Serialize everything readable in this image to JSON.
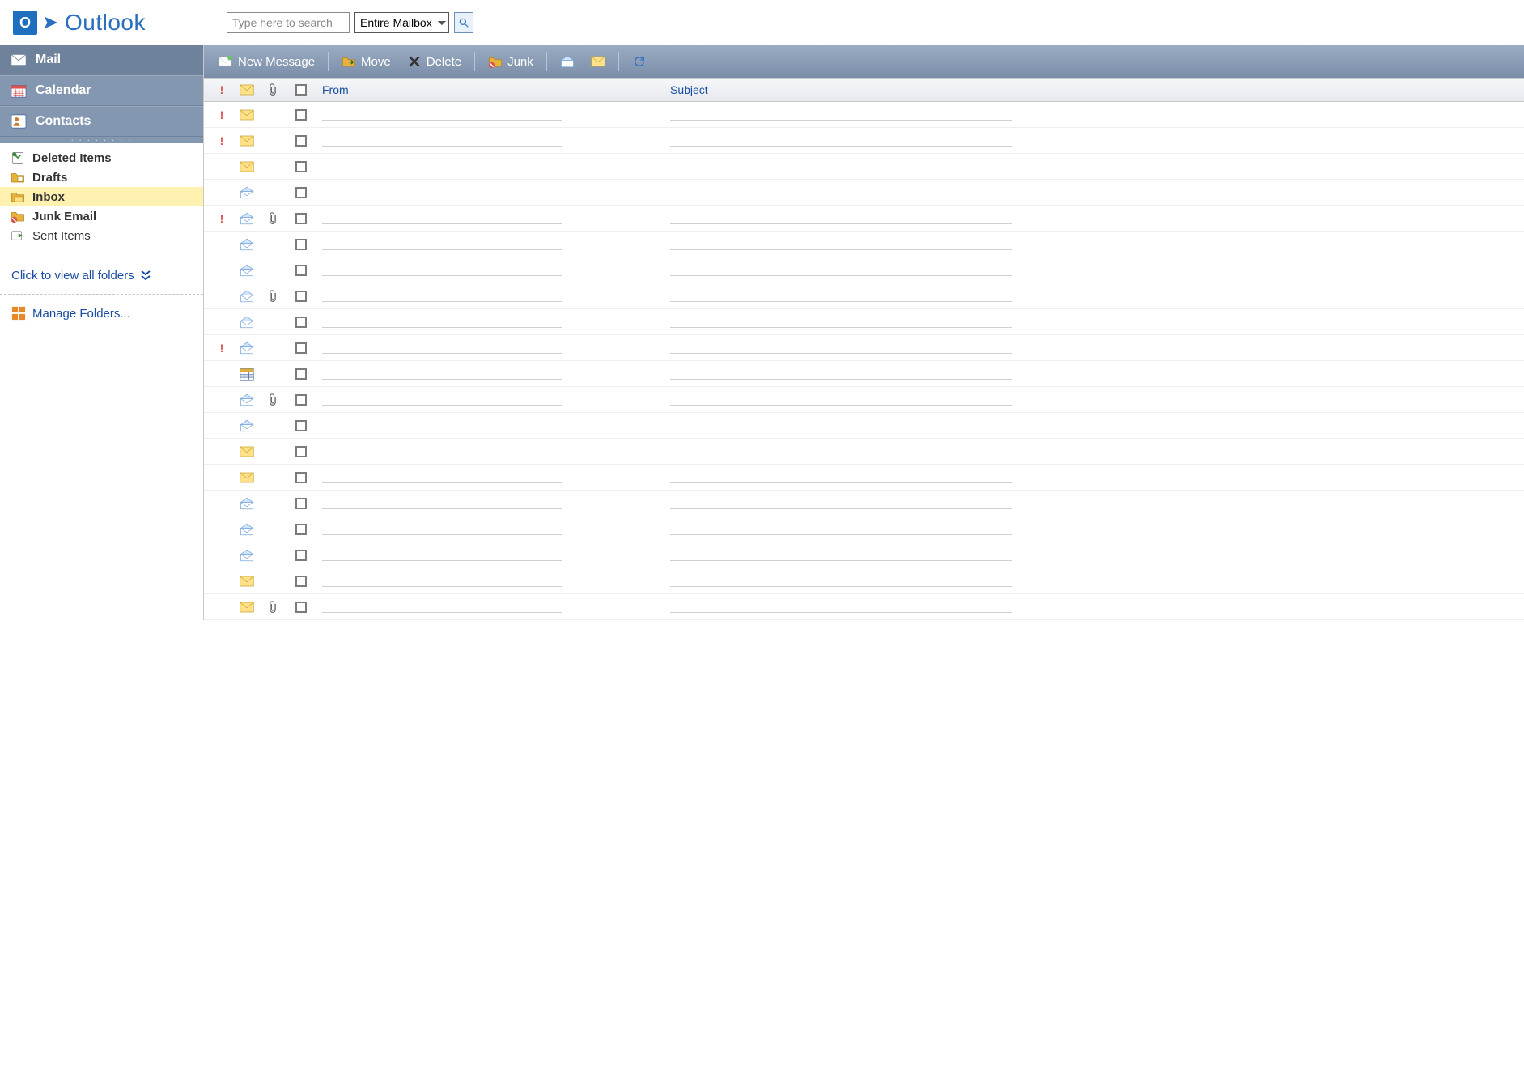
{
  "brand": {
    "az": "O",
    "name": "Outlook"
  },
  "search": {
    "placeholder": "Type here to search",
    "scope": "Entire Mailbox"
  },
  "nav": {
    "mail": "Mail",
    "calendar": "Calendar",
    "contacts": "Contacts"
  },
  "folders": [
    {
      "name": "Deleted Items",
      "icon": "trash",
      "bold": true,
      "selected": false
    },
    {
      "name": "Drafts",
      "icon": "drafts",
      "bold": true,
      "selected": false
    },
    {
      "name": "Inbox",
      "icon": "inbox",
      "bold": true,
      "selected": true
    },
    {
      "name": "Junk Email",
      "icon": "junk",
      "bold": true,
      "selected": false
    },
    {
      "name": "Sent Items",
      "icon": "sent",
      "bold": false,
      "selected": false
    }
  ],
  "sidebar_links": {
    "view_all": "Click to view all folders",
    "manage": "Manage Folders..."
  },
  "toolbar": {
    "new": "New Message",
    "move": "Move",
    "delete": "Delete",
    "junk": "Junk"
  },
  "columns": {
    "from": "From",
    "subject": "Subject"
  },
  "messages": [
    {
      "importance": true,
      "icon": "closed",
      "attach": false,
      "from": "",
      "subject": ""
    },
    {
      "importance": true,
      "icon": "closed",
      "attach": false,
      "from": "",
      "subject": ""
    },
    {
      "importance": false,
      "icon": "closed",
      "attach": false,
      "from": "",
      "subject": ""
    },
    {
      "importance": false,
      "icon": "open",
      "attach": false,
      "from": "",
      "subject": ""
    },
    {
      "importance": true,
      "icon": "open",
      "attach": true,
      "from": "",
      "subject": ""
    },
    {
      "importance": false,
      "icon": "open",
      "attach": false,
      "from": "",
      "subject": ""
    },
    {
      "importance": false,
      "icon": "open",
      "attach": false,
      "from": "",
      "subject": ""
    },
    {
      "importance": false,
      "icon": "open",
      "attach": true,
      "from": "",
      "subject": ""
    },
    {
      "importance": false,
      "icon": "open",
      "attach": false,
      "from": "",
      "subject": ""
    },
    {
      "importance": true,
      "icon": "open",
      "attach": false,
      "from": "",
      "subject": ""
    },
    {
      "importance": false,
      "icon": "calendar",
      "attach": false,
      "from": "",
      "subject": ""
    },
    {
      "importance": false,
      "icon": "open",
      "attach": true,
      "from": "",
      "subject": ""
    },
    {
      "importance": false,
      "icon": "open",
      "attach": false,
      "from": "",
      "subject": ""
    },
    {
      "importance": false,
      "icon": "closed",
      "attach": false,
      "from": "",
      "subject": ""
    },
    {
      "importance": false,
      "icon": "closed",
      "attach": false,
      "from": "",
      "subject": ""
    },
    {
      "importance": false,
      "icon": "open",
      "attach": false,
      "from": "",
      "subject": ""
    },
    {
      "importance": false,
      "icon": "open",
      "attach": false,
      "from": "",
      "subject": ""
    },
    {
      "importance": false,
      "icon": "open",
      "attach": false,
      "from": "",
      "subject": ""
    },
    {
      "importance": false,
      "icon": "closed",
      "attach": false,
      "from": "",
      "subject": ""
    },
    {
      "importance": false,
      "icon": "closed",
      "attach": true,
      "from": "",
      "subject": ""
    }
  ]
}
